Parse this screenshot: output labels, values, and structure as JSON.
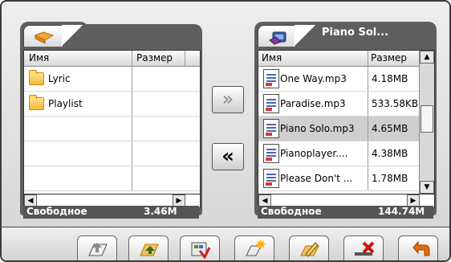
{
  "left_pane": {
    "header_name": "Имя",
    "header_size": "Размер",
    "items": [
      {
        "name": "Lyric",
        "size": ""
      },
      {
        "name": "Playlist",
        "size": ""
      },
      {
        "name": "",
        "size": ""
      },
      {
        "name": "",
        "size": ""
      },
      {
        "name": "",
        "size": ""
      }
    ],
    "free_label": "Свободное",
    "free_value": "3.46M"
  },
  "right_pane": {
    "title": "Piano Sol...",
    "header_name": "Имя",
    "header_size": "Размер",
    "items": [
      {
        "name": "One Way.mp3",
        "size": "4.18MB"
      },
      {
        "name": "Paradise.mp3",
        "size": "533.58KB"
      },
      {
        "name": "Piano Solo.mp3",
        "size": "4.65MB"
      },
      {
        "name": "Pianoplayer....",
        "size": "4.38MB"
      },
      {
        "name": "Please Don't ...",
        "size": "1.78MB"
      }
    ],
    "free_label": "Свободное",
    "free_value": "144.74M"
  },
  "transfer": {
    "right_label": "»",
    "left_label": "«"
  },
  "toolbar": {
    "icons": [
      "back-to-root-icon",
      "up-folder-icon",
      "select-icon",
      "new-folder-icon",
      "rename-icon",
      "delete-icon",
      "return-icon"
    ]
  }
}
